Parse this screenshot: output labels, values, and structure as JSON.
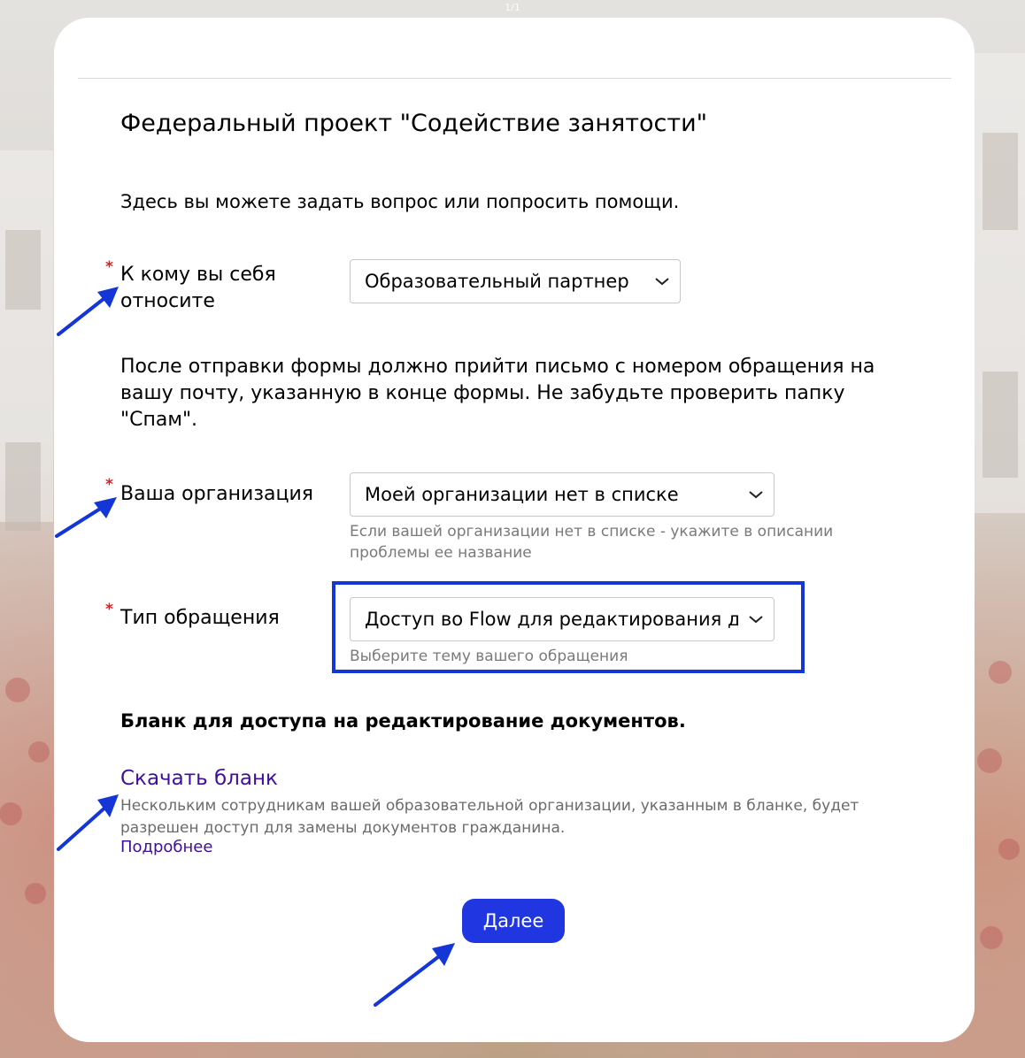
{
  "pager": "1/1",
  "form": {
    "title": "Федеральный проект \"Содействие занятости\"",
    "intro": "Здесь вы можете задать вопрос или попросить помощи.",
    "required_mark": "*",
    "role": {
      "label": "К кому вы себя относите",
      "value": "Образовательный партнер"
    },
    "notice": "После отправки формы должно прийти письмо с номером обращения на вашу почту, указанную в конце формы. Не забудьте проверить папку \"Спам\".",
    "organization": {
      "label": "Ваша организация",
      "value": "Моей организации нет в списке",
      "hint": "Если вашей организации нет в списке - укажите в описании проблемы ее название"
    },
    "request_type": {
      "label": "Тип обращения",
      "value": "Доступ во Flow для редактирования д",
      "hint": "Выберите тему вашего обращения"
    },
    "blank_heading": "Бланк для доступа на редактирование документов.",
    "download_link": "Скачать бланк",
    "download_description": "Нескольким сотрудникам вашей образовательной организации, указанным в бланке, будет разрешен доступ для замены документов гражданина.",
    "more_link": "Подробнее",
    "next_button": "Далее"
  },
  "colors": {
    "accent_button": "#1f36e0",
    "link": "#3e0f9e",
    "required": "#e21b1b",
    "annotation": "#1436d6"
  },
  "icons": {
    "select_chevron": "chevron-down-icon",
    "annotation_arrow": "arrow-annotation-icon"
  }
}
